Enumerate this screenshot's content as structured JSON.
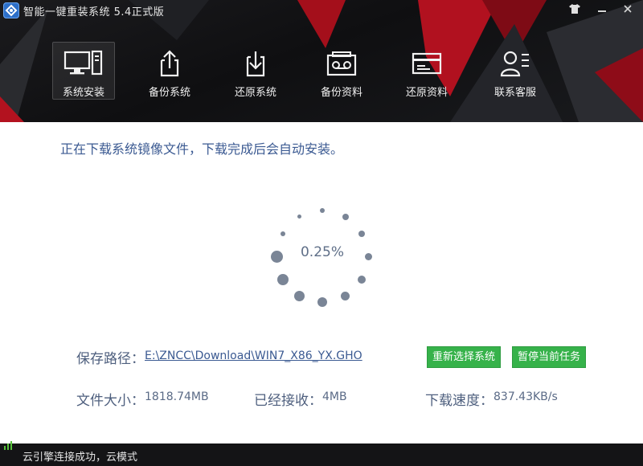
{
  "window": {
    "title": "智能一键重装系统 5.4正式版",
    "controls": [
      "skin",
      "minimize",
      "close"
    ]
  },
  "nav": {
    "items": [
      {
        "label": "系统安装",
        "icon": "computer-icon",
        "active": true
      },
      {
        "label": "备份系统",
        "icon": "upload-icon",
        "active": false
      },
      {
        "label": "还原系统",
        "icon": "download-icon",
        "active": false
      },
      {
        "label": "备份资料",
        "icon": "tape-icon",
        "active": false
      },
      {
        "label": "还原资料",
        "icon": "card-icon",
        "active": false
      },
      {
        "label": "联系客服",
        "icon": "contact-icon",
        "active": false
      }
    ]
  },
  "main": {
    "message": "正在下载系统镜像文件，下载完成后会自动安装。",
    "progress": {
      "percent_text": "0.25%",
      "value": 0.25
    },
    "save_path_label": "保存路径：",
    "save_path_value": "E:\\ZNCC\\Download\\WIN7_X86_YX.GHO",
    "file_size_label": "文件大小：",
    "file_size_value": "1818.74MB",
    "received_label": "已经接收：",
    "received_value": "4MB",
    "speed_label": "下载速度：",
    "speed_value": "837.43KB/s",
    "reselect_button": "重新选择系统",
    "pause_button": "暂停当前任务"
  },
  "status": {
    "text": "云引擎连接成功，云模式",
    "accent": "#57c13b"
  },
  "colors": {
    "header_bg": "#141416",
    "accent_red": "#c0101f",
    "text_blue": "#3b5a92",
    "button_green": "#36b24a",
    "spinner_gray": "#7a8596"
  }
}
